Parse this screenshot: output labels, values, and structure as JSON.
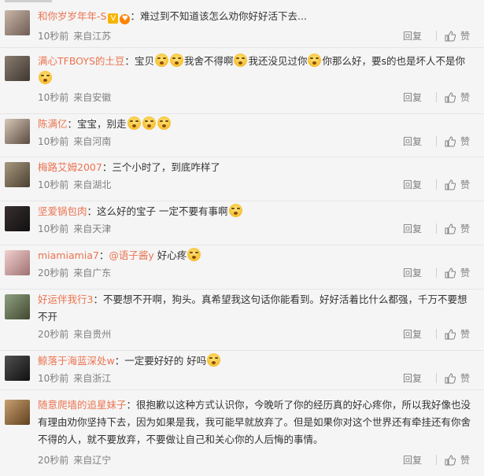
{
  "comments": [
    {
      "user": "和你岁岁年年-S",
      "text": "难过到不知道该怎么劝你好好活下去...",
      "time": "10秒前",
      "loc": "来自江苏",
      "emojis": 0
    },
    {
      "user": "满心TFBOYS的土豆",
      "text": "宝贝",
      "text2": "我舍不得啊",
      "text3": "我还没见过你",
      "text4": "你那么好，要s的也是坏人不是你",
      "time": "10秒前",
      "loc": "来自安徽"
    },
    {
      "user": "陈满亿",
      "text": "宝宝，别走",
      "time": "10秒前",
      "loc": "来自河南"
    },
    {
      "user": "梅路艾姆2007",
      "text": "三个小时了，到底咋样了",
      "time": "10秒前",
      "loc": "来自湖北"
    },
    {
      "user": "坚爱锅包肉",
      "text": "这么好的宝子 一定不要有事啊",
      "time": "10秒前",
      "loc": "来自天津"
    },
    {
      "user": "miamiamia7",
      "mention": "@语子酱y",
      "text": "好心疼",
      "time": "20秒前",
      "loc": "来自广东"
    },
    {
      "user": "好运伴我行3",
      "text": "不要想不开啊，狗头。真希望我这句话你能看到。好好活着比什么都强，千万不要想不开",
      "time": "20秒前",
      "loc": "来自贵州"
    },
    {
      "user": "鲸落于海蓝深处w",
      "text": "一定要好好的 好吗",
      "time": "10秒前",
      "loc": "来自浙江"
    },
    {
      "user": "随意爬墙的追星妹子",
      "text": "很抱歉以这种方式认识你，今晚听了你的经历真的好心疼你，所以我好像也没有理由劝你坚持下去，因为如果是我，我可能早就放弃了。但是如果你对这个世界还有牵挂还有你舍不得的人，就不要放弃，不要做让自己和关心你的人后悔的事情。",
      "time": "20秒前",
      "loc": "来自辽宁"
    }
  ],
  "ui": {
    "reply_label": "回复",
    "like_label": "赞",
    "colon": "："
  },
  "colors": {
    "username": "#eb7350",
    "meta": "#808080",
    "background": "#f5f5f5"
  },
  "icons": {
    "like": "thumbs-up-icon",
    "vip": "v-badge-icon",
    "emoji": "crying-emoji-icon"
  }
}
